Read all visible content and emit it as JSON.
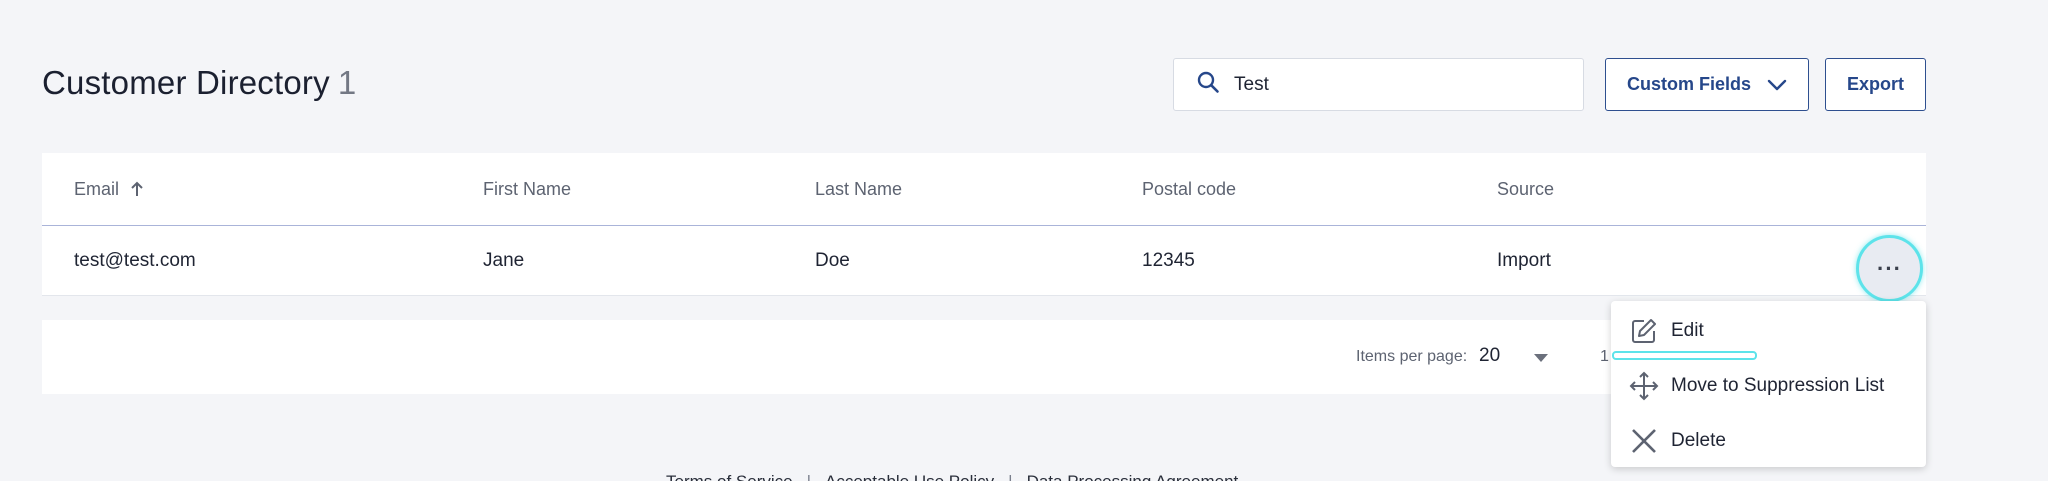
{
  "header": {
    "title": "Customer Directory",
    "count": "1"
  },
  "search": {
    "value": "Test",
    "placeholder": "Search"
  },
  "buttons": {
    "custom_fields": "Custom Fields",
    "export": "Export"
  },
  "table": {
    "columns": [
      "Email",
      "First Name",
      "Last Name",
      "Postal code",
      "Source"
    ],
    "sort_column": "Email",
    "sort_direction": "ascending",
    "rows": [
      {
        "email": "test@test.com",
        "first_name": "Jane",
        "last_name": "Doe",
        "postal_code": "12345",
        "source": "Import"
      }
    ]
  },
  "row_actions": {
    "trigger_label": "···",
    "items": [
      {
        "label": "Edit",
        "icon": "edit-icon"
      },
      {
        "label": "Move to Suppression List",
        "icon": "move-icon"
      },
      {
        "label": "Delete",
        "icon": "close-icon"
      }
    ]
  },
  "pagination": {
    "items_per_page_label": "Items per page:",
    "items_per_page": "20",
    "page_text": "1"
  },
  "footer": {
    "links": [
      "Terms of Service",
      "Acceptable Use Policy",
      "Data Processing Agreement"
    ]
  },
  "colors": {
    "accent": "#26478a",
    "highlight": "#5de3ea",
    "background": "#f4f5f8"
  }
}
